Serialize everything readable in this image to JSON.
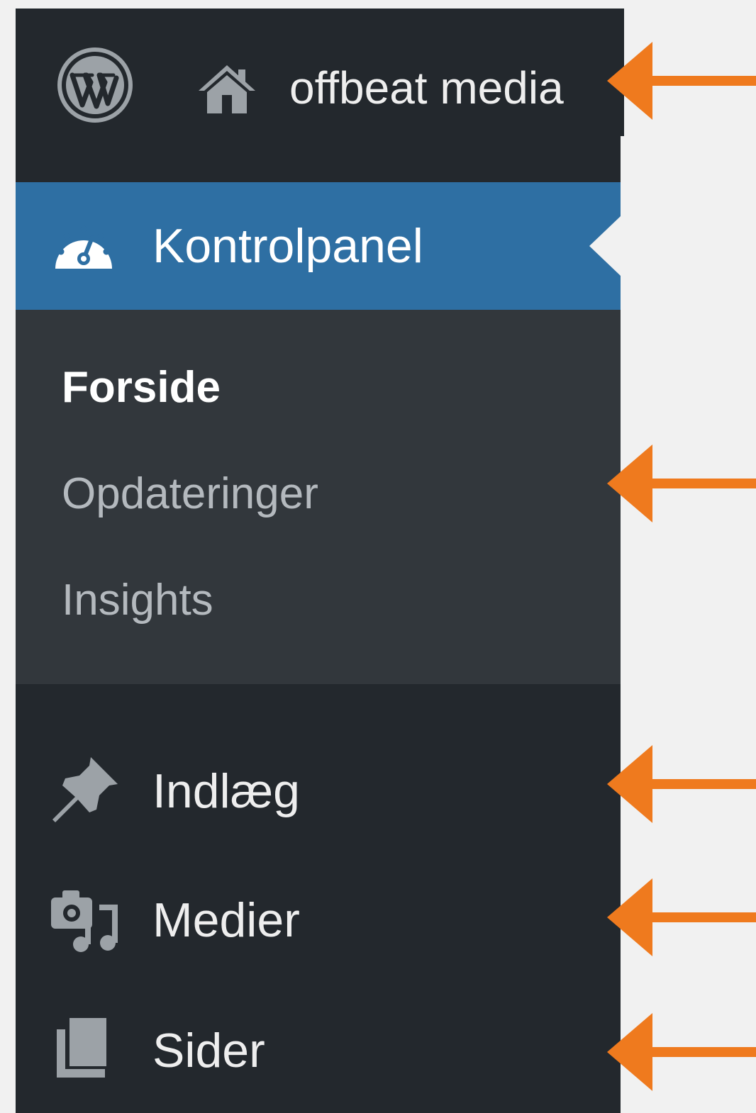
{
  "adminbar": {
    "logo_icon": "wordpress-logo-icon",
    "home_icon": "home-icon",
    "site_name": "offbeat media"
  },
  "sidemenu": {
    "current": {
      "icon": "dashboard-gauge-icon",
      "label": "Kontrolpanel"
    },
    "submenu": [
      {
        "label": "Forside",
        "active": true
      },
      {
        "label": "Opdateringer",
        "active": false
      },
      {
        "label": "Insights",
        "active": false
      }
    ],
    "items": [
      {
        "icon": "pushpin-icon",
        "label": "Indlæg"
      },
      {
        "icon": "media-camera-music-icon",
        "label": "Medier"
      },
      {
        "icon": "pages-icon",
        "label": "Sider"
      }
    ]
  },
  "colors": {
    "menu_background": "#23282d",
    "submenu_background": "#32373c",
    "current_item_background": "#2e6fa3",
    "page_background": "#f1f1f1",
    "annotation_arrow": "#ef7a1e"
  }
}
